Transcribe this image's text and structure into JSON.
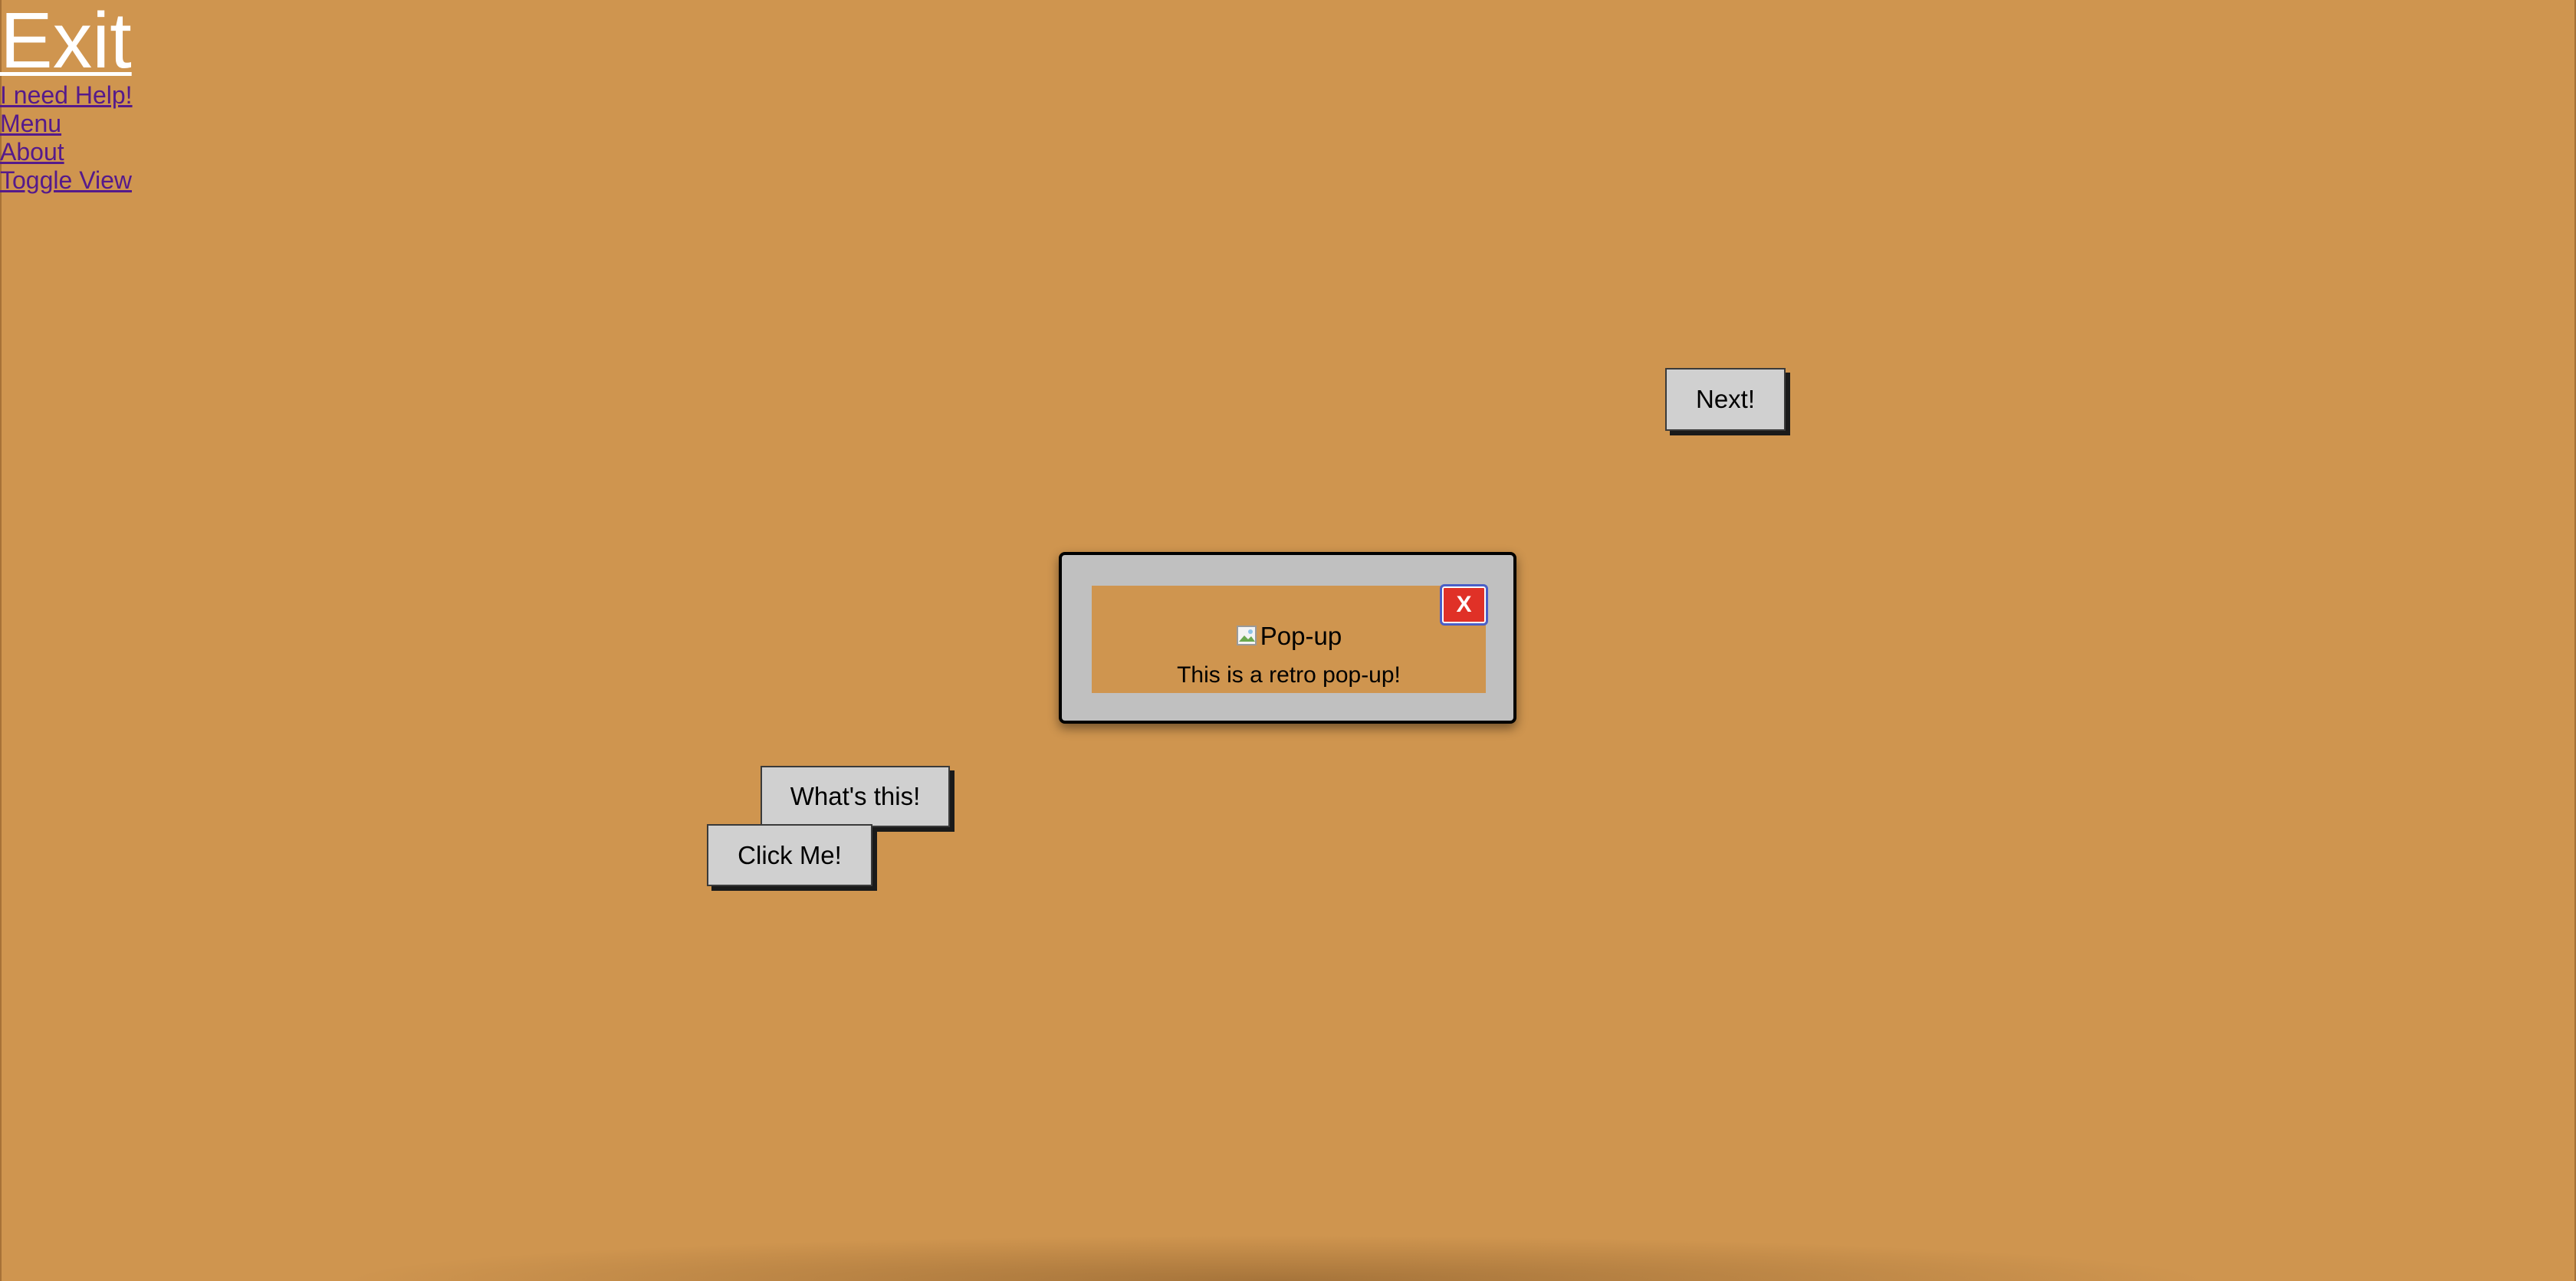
{
  "links": {
    "exit": "Exit",
    "items": [
      "I need Help!",
      "Menu",
      "About",
      "Toggle View"
    ]
  },
  "buttons": {
    "next": "Next!",
    "whats_this": "What's this!",
    "click_me": "Click Me!"
  },
  "popup": {
    "image_alt": "Pop-up",
    "message": "This is a retro pop-up!",
    "close_label": "X"
  },
  "colors": {
    "background": "#cf954f",
    "button_face": "#d0d0d0",
    "popup_frame": "#c0c0c0",
    "close_button": "#e03127",
    "exit_link": "#ffffff",
    "nav_link": "#551a8b"
  }
}
